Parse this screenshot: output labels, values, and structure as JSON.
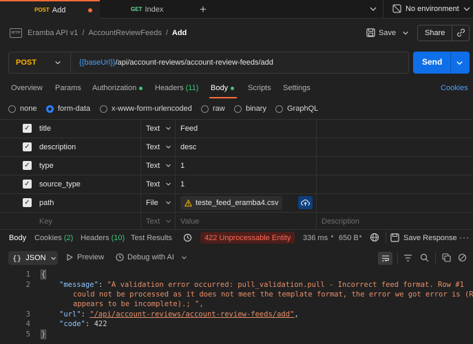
{
  "tabs": [
    {
      "method": "POST",
      "label": "Add",
      "active": true,
      "unsaved": true
    },
    {
      "method": "GET",
      "label": "Index",
      "active": false
    }
  ],
  "environment": "No environment",
  "breadcrumb": {
    "collection": "Eramba API v1",
    "folder": "AccountReviewFeeds",
    "current": "Add"
  },
  "actions": {
    "save": "Save",
    "share": "Share"
  },
  "request": {
    "method": "POST",
    "url_var": "{{baseUrl}}",
    "url_path": "/api/account-reviews/account-review-feeds/add",
    "send": "Send"
  },
  "request_tabs": {
    "overview": "Overview",
    "params": "Params",
    "authorization": "Authorization",
    "headers": "Headers",
    "headers_count": "(11)",
    "body": "Body",
    "scripts": "Scripts",
    "settings": "Settings",
    "cookies": "Cookies"
  },
  "body_types": [
    "none",
    "form-data",
    "x-www-form-urlencoded",
    "raw",
    "binary",
    "GraphQL"
  ],
  "form_rows": [
    {
      "key": "title",
      "type": "Text",
      "value": "Feed"
    },
    {
      "key": "description",
      "type": "Text",
      "value": "desc"
    },
    {
      "key": "type",
      "type": "Text",
      "value": "1"
    },
    {
      "key": "source_type",
      "type": "Text",
      "value": "1"
    },
    {
      "key": "path",
      "type": "File",
      "value": "teste_feed_eramba4.csv"
    }
  ],
  "form_placeholders": {
    "key": "Key",
    "type": "Text",
    "value": "Value",
    "description": "Description"
  },
  "response_tabs": {
    "body": "Body",
    "cookies": "Cookies",
    "cookies_count": "(2)",
    "headers": "Headers",
    "headers_count": "(10)",
    "test_results": "Test Results"
  },
  "response_meta": {
    "status": "422 Unprocessable Entity",
    "time": "336 ms",
    "size": "650 B",
    "save_response": "Save Response"
  },
  "response_toolbar": {
    "format": "JSON",
    "preview": "Preview",
    "debug": "Debug with AI"
  },
  "response_code": {
    "line_numbers": [
      "1",
      "2",
      "3",
      "4",
      "5"
    ],
    "open_brace": "{",
    "close_brace": "}",
    "message_key": "\"message\"",
    "message_line1": "\"A validation error occurred: pull_validation.pull - Incorrect feed format. Row #1",
    "message_line2": "could not be processed as it does not meet the template format, the error we got error is (Row",
    "message_line3": "appears to be incomplete).; \",",
    "url_key": "\"url\"",
    "url_value": "\"/api/account-reviews/account-review-feeds/add\"",
    "code_key": "\"code\"",
    "code_value": "422"
  },
  "colors": {
    "accent": "#ff6c37",
    "send": "#0f6fe8",
    "status_error": "#ff6b5a",
    "success": "#3cc97a"
  }
}
